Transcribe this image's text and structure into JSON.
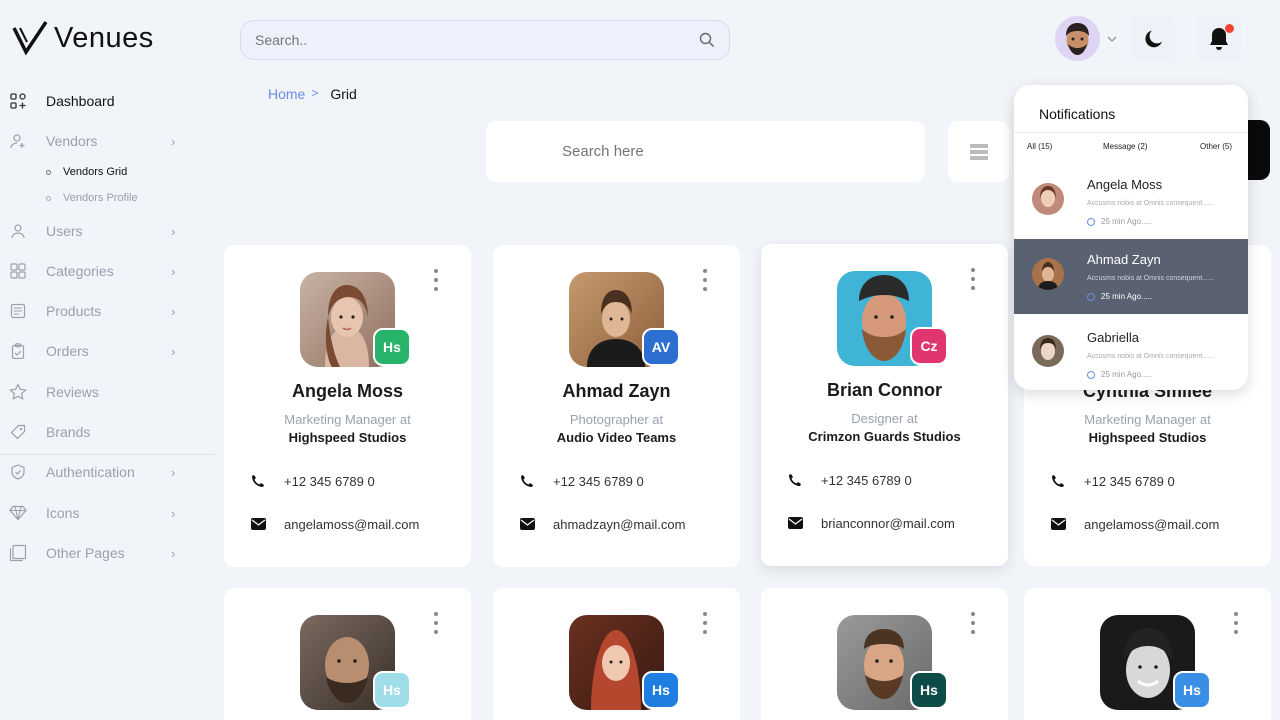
{
  "brand": {
    "name": "Venues"
  },
  "header": {
    "search_placeholder": "Search.."
  },
  "sidebar": {
    "items": [
      {
        "label": "Dashboard",
        "icon": "dashboard-icon",
        "active": true
      },
      {
        "label": "Vendors",
        "icon": "user-plus-icon",
        "chevron": true
      },
      {
        "label": "Users",
        "icon": "user-icon",
        "chevron": true
      },
      {
        "label": "Categories",
        "icon": "grid-icon",
        "chevron": true
      },
      {
        "label": "Products",
        "icon": "box-icon",
        "chevron": true
      },
      {
        "label": "Orders",
        "icon": "clipboard-icon",
        "chevron": true
      },
      {
        "label": "Reviews",
        "icon": "star-icon"
      },
      {
        "label": "Brands",
        "icon": "tag-icon"
      },
      {
        "label": "Authentication",
        "icon": "shield-icon",
        "chevron": true
      },
      {
        "label": "Icons",
        "icon": "diamond-icon",
        "chevron": true
      },
      {
        "label": "Other Pages",
        "icon": "pages-icon",
        "chevron": true
      }
    ],
    "vendor_sub": [
      {
        "label": "Vendors Grid"
      },
      {
        "label": "Vendors Profile"
      }
    ]
  },
  "breadcrumb": {
    "home": "Home",
    "separator": ">",
    "current": "Grid"
  },
  "page_search": {
    "placeholder": "Search here"
  },
  "cards": [
    {
      "name": "Angela Moss",
      "role": "Marketing Manager at",
      "company": "Highspeed Studios",
      "phone": "+12 345 6789 0",
      "email": "angelamoss@mail.com",
      "badge": "Hs",
      "badge_color": "#27b36a",
      "photo_bg": "#b89a8a"
    },
    {
      "name": "Ahmad Zayn",
      "role": "Photographer at",
      "company": "Audio Video Teams",
      "phone": "+12 345 6789 0",
      "email": "ahmadzayn@mail.com",
      "badge": "AV",
      "badge_color": "#2c6fd1",
      "photo_bg": "#b0825a"
    },
    {
      "name": "Brian Connor",
      "role": "Designer at",
      "company": "Crimzon Guards Studios",
      "phone": "+12 345 6789 0",
      "email": "brianconnor@mail.com",
      "badge": "Cz",
      "badge_color": "#e0356f",
      "photo_bg": "#3fb4d6"
    },
    {
      "name": "Cynthia Smilee",
      "role": "Marketing Manager at",
      "company": "Highspeed Studios",
      "phone": "+12 345 6789 0",
      "email": "angelamoss@mail.com",
      "badge": "",
      "badge_color": "#27b36a",
      "photo_bg": "#cccccc"
    },
    {
      "badge": "Hs",
      "badge_color": "#9fdde8",
      "photo_bg": "#6a5a50"
    },
    {
      "badge": "Hs",
      "badge_color": "#1e7fe0",
      "photo_bg": "#a0452e"
    },
    {
      "badge": "Hs",
      "badge_color": "#0e4d47",
      "photo_bg": "#8a7a6a"
    },
    {
      "badge": "Hs",
      "badge_color": "#3a8ee6",
      "photo_bg": "#4a4a4a"
    }
  ],
  "notifications": {
    "title": "Notifications",
    "tabs": [
      "All (15)",
      "Message (2)",
      "Other (5)"
    ],
    "items": [
      {
        "name": "Angela Moss",
        "message": "Accusms nobis at Omnis consequent......",
        "time": "25 min Ago.....",
        "av_color": "#c08a7a",
        "selected": false
      },
      {
        "name": "Ahmad Zayn",
        "message": "Accusms nobis at Omnis consequent......",
        "time": "25 min Ago.....",
        "av_color": "#a8734a",
        "selected": true
      },
      {
        "name": "Gabriella",
        "message": "Accusms nobis at Omnis consequent......",
        "time": "25 min Ago.....",
        "av_color": "#7a6a5a",
        "selected": false
      }
    ]
  }
}
